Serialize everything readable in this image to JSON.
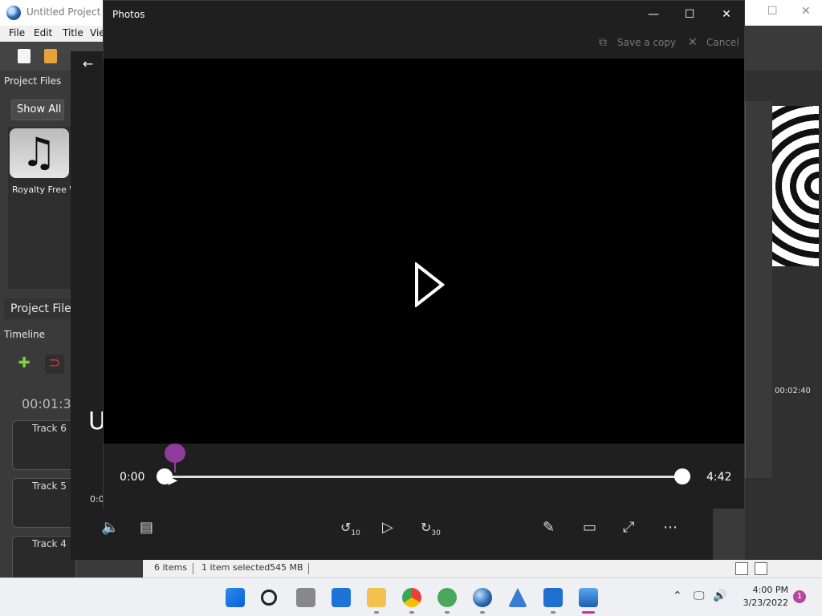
{
  "background_app": {
    "title": "Untitled Project [H",
    "menu": [
      "File",
      "Edit",
      "Title",
      "Vie"
    ],
    "project_files_label": "Project Files",
    "show_all_label": "Show All",
    "file_item_label": "Royalty Free W",
    "project_files_tab": "Project Files",
    "timeline_label": "Timeline",
    "timecode": "00:01:30",
    "tracks": [
      "Track 6",
      "Track 5",
      "Track 4"
    ],
    "right_time": "00:02:40",
    "overlay_text": "U",
    "overlay_time": "0:0"
  },
  "photos": {
    "title": "Photos",
    "save_copy_label": "Save a copy",
    "cancel_label": "Cancel",
    "time_current": "0:00",
    "time_total": "4:42",
    "rewind_label": "10",
    "forward_label": "30"
  },
  "statusbar": {
    "items_count": "6 items",
    "selection": "1 item selected",
    "size": "545 MB"
  },
  "taskbar": {
    "time": "4:00 PM",
    "date": "3/23/2022",
    "notification_count": "1"
  },
  "colors": {
    "accent_purple": "#8e3c9c",
    "photos_bg": "#1f1f1f",
    "taskbar_bg": "#eef0f4"
  }
}
